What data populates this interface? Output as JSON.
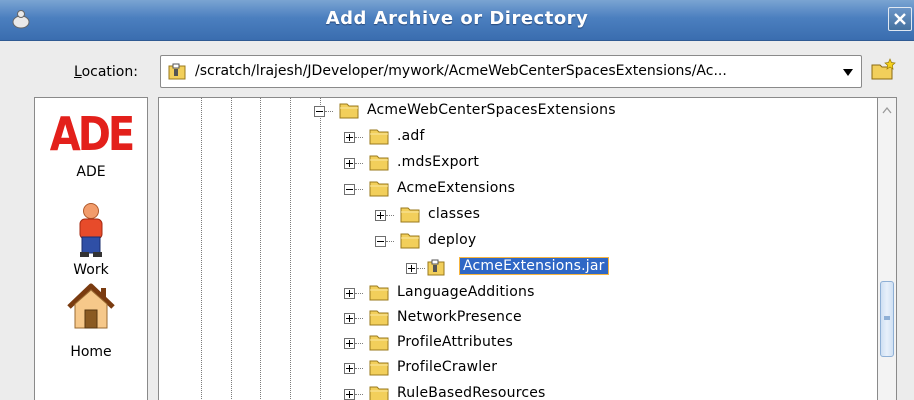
{
  "window": {
    "title": "Add Archive or Directory"
  },
  "location": {
    "label": "Location:",
    "label_mnemonic": "L",
    "label_rest": "ocation:",
    "path": "/scratch/lrajesh/JDeveloper/mywork/AcmeWebCenterSpacesExtensions/Ac..."
  },
  "places": [
    {
      "label": "ADE",
      "logo_text": "ADE"
    },
    {
      "label": "Work"
    },
    {
      "label": "Home"
    }
  ],
  "tree": [
    {
      "label": "AcmeWebCenterSpacesExtensions",
      "expanded": true,
      "type": "folder"
    },
    {
      "label": ".adf",
      "expanded": false,
      "type": "folder"
    },
    {
      "label": ".mdsExport",
      "expanded": false,
      "type": "folder"
    },
    {
      "label": "AcmeExtensions",
      "expanded": true,
      "type": "folder"
    },
    {
      "label": "classes",
      "expanded": false,
      "type": "folder"
    },
    {
      "label": "deploy",
      "expanded": true,
      "type": "folder"
    },
    {
      "label": "AcmeExtensions.jar",
      "expanded": false,
      "type": "archive",
      "selected": true
    },
    {
      "label": "LanguageAdditions",
      "expanded": false,
      "type": "folder"
    },
    {
      "label": "NetworkPresence",
      "expanded": false,
      "type": "folder"
    },
    {
      "label": "ProfileAttributes",
      "expanded": false,
      "type": "folder"
    },
    {
      "label": "ProfileCrawler",
      "expanded": false,
      "type": "folder"
    },
    {
      "label": "RuleBasedResources",
      "expanded": false,
      "type": "folder"
    }
  ],
  "colors": {
    "titlebar": "#3a6daf",
    "selection": "#2f67c5",
    "selection_border": "#f7b53f",
    "folder": "#f2cf5b",
    "ade_logo": "#e3201b"
  }
}
